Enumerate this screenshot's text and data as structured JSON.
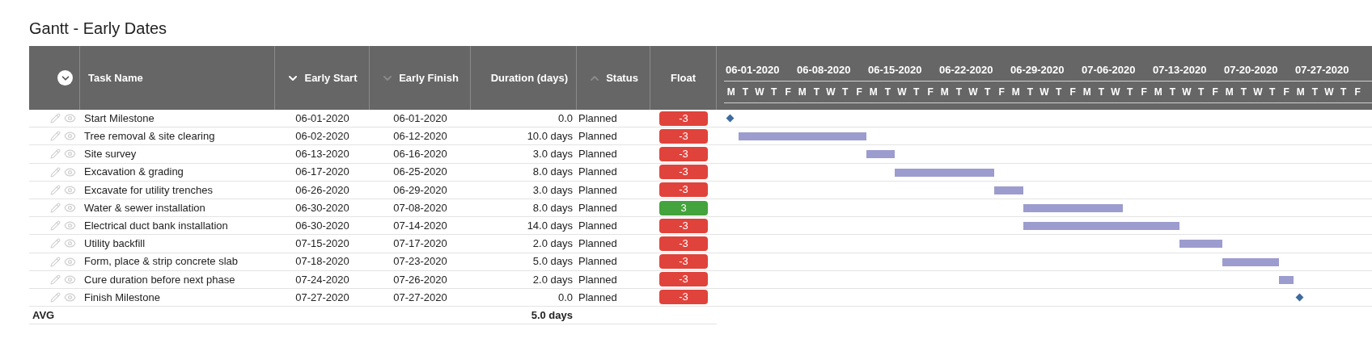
{
  "title": "Gantt - Early Dates",
  "columns": [
    {
      "label": "Task Name"
    },
    {
      "label": "Early Start",
      "sort": {
        "descending": true,
        "active": true
      }
    },
    {
      "label": "Early Finish",
      "sort": {
        "descending": true,
        "active": false
      }
    },
    {
      "label": "Duration (days)"
    },
    {
      "label": "Status",
      "sort": {
        "descending": false,
        "active": false
      }
    },
    {
      "label": "Float"
    }
  ],
  "timeline": {
    "weeks": [
      {
        "label": "06-01-2020",
        "days": [
          "M",
          "T",
          "W",
          "T",
          "F"
        ]
      },
      {
        "label": "06-08-2020",
        "days": [
          "M",
          "T",
          "W",
          "T",
          "F"
        ]
      },
      {
        "label": "06-15-2020",
        "days": [
          "M",
          "T",
          "W",
          "T",
          "F"
        ]
      },
      {
        "label": "06-22-2020",
        "days": [
          "M",
          "T",
          "W",
          "T",
          "F"
        ]
      },
      {
        "label": "06-29-2020",
        "days": [
          "M",
          "T",
          "W",
          "T",
          "F"
        ]
      },
      {
        "label": "07-06-2020",
        "days": [
          "M",
          "T",
          "W",
          "T",
          "F"
        ]
      },
      {
        "label": "07-13-2020",
        "days": [
          "M",
          "T",
          "W",
          "T",
          "F"
        ]
      },
      {
        "label": "07-20-2020",
        "days": [
          "M",
          "T",
          "W",
          "T",
          "F"
        ]
      },
      {
        "label": "07-27-2020",
        "days": [
          "M",
          "T",
          "W",
          "T",
          "F"
        ]
      }
    ]
  },
  "rows": [
    {
      "kind": "milestone",
      "name": "Start Milestone",
      "early_start": "06-01-2020",
      "early_finish": "06-01-2020",
      "duration": "0.0",
      "status": "Planned",
      "float": "-3",
      "color": "#e0433b"
    },
    {
      "kind": "task",
      "name": "Tree removal & site clearing",
      "early_start": "06-02-2020",
      "early_finish": "06-12-2020",
      "duration": "10.0 days",
      "status": "Planned",
      "float": "-3",
      "color": "#e0433b"
    },
    {
      "kind": "task",
      "name": "Site survey",
      "early_start": "06-13-2020",
      "early_finish": "06-16-2020",
      "duration": "3.0 days",
      "status": "Planned",
      "float": "-3",
      "color": "#e0433b"
    },
    {
      "kind": "task",
      "name": "Excavation & grading",
      "early_start": "06-17-2020",
      "early_finish": "06-25-2020",
      "duration": "8.0 days",
      "status": "Planned",
      "float": "-3",
      "color": "#e0433b"
    },
    {
      "kind": "task",
      "name": "Excavate for utility trenches",
      "early_start": "06-26-2020",
      "early_finish": "06-29-2020",
      "duration": "3.0 days",
      "status": "Planned",
      "float": "-3",
      "color": "#e0433b"
    },
    {
      "kind": "task",
      "name": "Water & sewer installation",
      "early_start": "06-30-2020",
      "early_finish": "07-08-2020",
      "duration": "8.0 days",
      "status": "Planned",
      "float": "3",
      "color": "#43a33c"
    },
    {
      "kind": "task",
      "name": "Electrical duct bank installation",
      "early_start": "06-30-2020",
      "early_finish": "07-14-2020",
      "duration": "14.0 days",
      "status": "Planned",
      "float": "-3",
      "color": "#e0433b"
    },
    {
      "kind": "task",
      "name": "Utility backfill",
      "early_start": "07-15-2020",
      "early_finish": "07-17-2020",
      "duration": "2.0 days",
      "status": "Planned",
      "float": "-3",
      "color": "#e0433b"
    },
    {
      "kind": "task",
      "name": "Form, place & strip concrete slab",
      "early_start": "07-18-2020",
      "early_finish": "07-23-2020",
      "duration": "5.0 days",
      "status": "Planned",
      "float": "-3",
      "color": "#e0433b"
    },
    {
      "kind": "task",
      "name": "Cure duration before next phase",
      "early_start": "07-24-2020",
      "early_finish": "07-26-2020",
      "duration": "2.0 days",
      "status": "Planned",
      "float": "-3",
      "color": "#e0433b"
    },
    {
      "kind": "milestone",
      "name": "Finish Milestone",
      "early_start": "07-27-2020",
      "early_finish": "07-27-2020",
      "duration": "0.0",
      "status": "Planned",
      "float": "-3",
      "color": "#e0433b"
    }
  ],
  "summary": {
    "label": "AVG",
    "duration": "5.0 days"
  }
}
